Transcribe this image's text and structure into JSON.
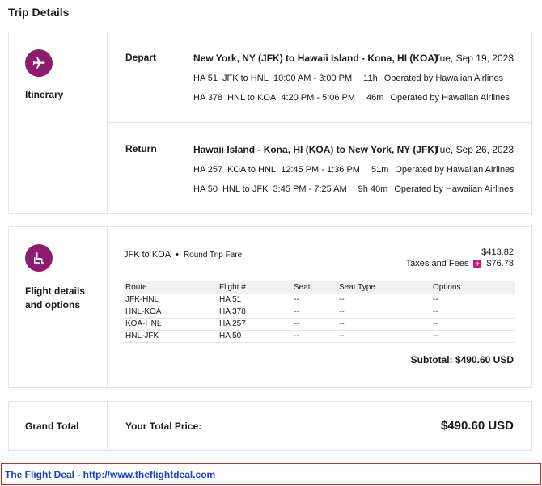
{
  "page": {
    "title": "Trip Details"
  },
  "colors": {
    "accent": "#8e1b6e",
    "plus": "#d11874",
    "footer_border": "#e0201a",
    "footer_link": "#1a3ecf"
  },
  "itinerary": {
    "label": "Itinerary",
    "icon": "airplane-icon",
    "legs": [
      {
        "label": "Depart",
        "route": "New York, NY (JFK) to Hawaii Island - Kona, HI (KOA)",
        "date": "Tue, Sep 19, 2023",
        "segments": [
          {
            "flight": "HA 51",
            "airports": "JFK to HNL",
            "times": "10:00 AM - 3:00 PM",
            "duration": "11h",
            "operator": "Operated by Hawaiian Airlines"
          },
          {
            "flight": "HA 378",
            "airports": "HNL to KOA",
            "times": "4:20 PM - 5:06 PM",
            "duration": "46m",
            "operator": "Operated by Hawaiian Airlines"
          }
        ]
      },
      {
        "label": "Return",
        "route": "Hawaii Island - Kona, HI (KOA) to New York, NY (JFK)",
        "date": "Tue, Sep 26, 2023",
        "segments": [
          {
            "flight": "HA 257",
            "airports": "KOA to HNL",
            "times": "12:45 PM - 1:36 PM",
            "duration": "51m",
            "operator": "Operated by Hawaiian Airlines"
          },
          {
            "flight": "HA 50",
            "airports": "HNL to JFK",
            "times": "3:45 PM - 7:25 AM",
            "duration": "9h 40m",
            "operator": "Operated by Hawaiian Airlines"
          }
        ]
      }
    ]
  },
  "details": {
    "label_line1": "Flight details",
    "label_line2": "and options",
    "icon": "seat-icon",
    "fare_route": "JFK to KOA",
    "bullet": "•",
    "fare_type": "Round Trip Fare",
    "base_price": "$413.82",
    "taxes_label": "Taxes and Fees",
    "taxes_value": "$76.78",
    "plus": "+",
    "columns": [
      "Route",
      "Flight #",
      "Seat",
      "Seat Type",
      "Options"
    ],
    "rows": [
      [
        "JFK-HNL",
        "HA 51",
        "--",
        "--",
        "--"
      ],
      [
        "HNL-KOA",
        "HA 378",
        "--",
        "--",
        "--"
      ],
      [
        "KOA-HNL",
        "HA 257",
        "--",
        "--",
        "--"
      ],
      [
        "HNL-JFK",
        "HA 50",
        "--",
        "--",
        "--"
      ]
    ],
    "subtotal": "Subtotal:  $490.60 USD"
  },
  "total": {
    "label": "Grand Total",
    "your_total_label": "Your Total Price:",
    "value": "$490.60 USD"
  },
  "footer": {
    "text": "The Flight Deal - http://www.theflightdeal.com"
  }
}
